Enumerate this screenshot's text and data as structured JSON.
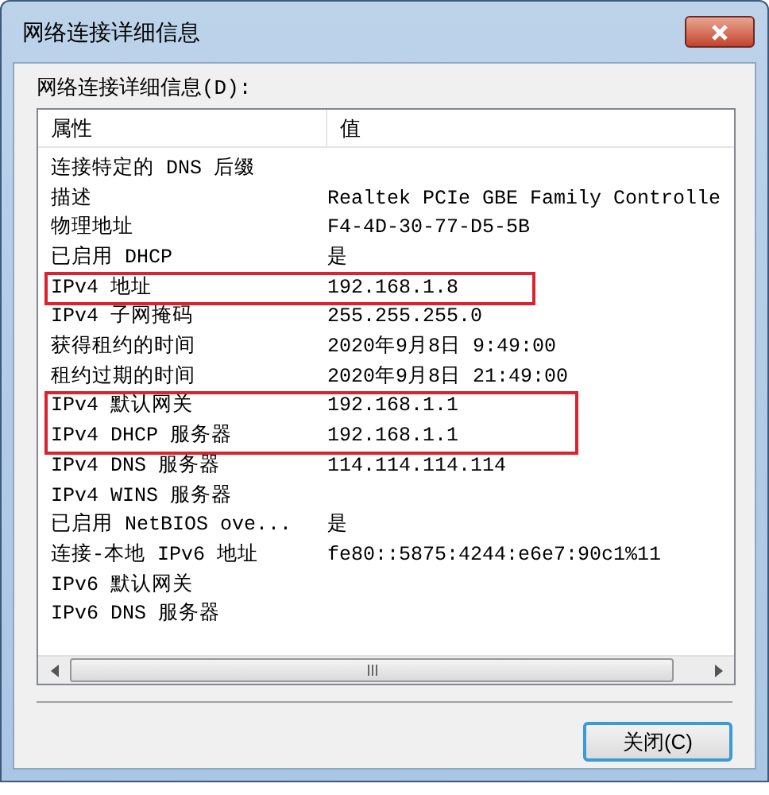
{
  "window": {
    "title": "网络连接详细信息"
  },
  "list_label": "网络连接详细信息(D):",
  "columns": [
    "属性",
    "值"
  ],
  "rows": [
    {
      "property": "连接特定的 DNS 后缀",
      "value": "",
      "highlighted": false
    },
    {
      "property": "描述",
      "value": "Realtek PCIe GBE Family Controlle",
      "highlighted": false
    },
    {
      "property": "物理地址",
      "value": "F4-4D-30-77-D5-5B",
      "highlighted": false
    },
    {
      "property": "已启用 DHCP",
      "value": "是",
      "highlighted": false
    },
    {
      "property": "IPv4 地址",
      "value": "192.168.1.8",
      "highlighted": true
    },
    {
      "property": "IPv4 子网掩码",
      "value": "255.255.255.0",
      "highlighted": false
    },
    {
      "property": "获得租约的时间",
      "value": "2020年9月8日 9:49:00",
      "highlighted": false
    },
    {
      "property": "租约过期的时间",
      "value": "2020年9月8日 21:49:00",
      "highlighted": false
    },
    {
      "property": "IPv4 默认网关",
      "value": "192.168.1.1",
      "highlighted": true
    },
    {
      "property": "IPv4 DHCP 服务器",
      "value": "192.168.1.1",
      "highlighted": true
    },
    {
      "property": "IPv4 DNS 服务器",
      "value": "114.114.114.114",
      "highlighted": false
    },
    {
      "property": "IPv4 WINS 服务器",
      "value": "",
      "highlighted": false
    },
    {
      "property": "已启用 NetBIOS ove...",
      "value": "是",
      "highlighted": false
    },
    {
      "property": "连接-本地 IPv6 地址",
      "value": "fe80::5875:4244:e6e7:90c1%11",
      "highlighted": false
    },
    {
      "property": "IPv6 默认网关",
      "value": "",
      "highlighted": false
    },
    {
      "property": "IPv6 DNS 服务器",
      "value": "",
      "highlighted": false
    }
  ],
  "buttons": [
    "关闭(C)"
  ]
}
